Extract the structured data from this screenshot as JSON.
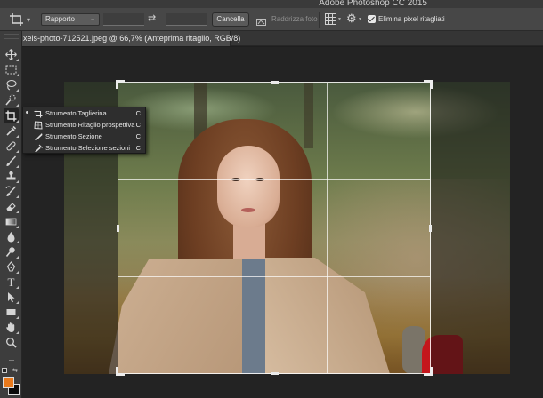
{
  "app": {
    "window_title": "Adobe Photoshop CC 2015"
  },
  "options_bar": {
    "ratio_select_value": "Rapporto",
    "width_value": "",
    "height_value": "",
    "cancel_label": "Cancella",
    "straighten_label": "Raddrizza foto",
    "delete_cropped_label": "Elimina pixel ritagliati",
    "delete_cropped_checked": true
  },
  "document_tab": {
    "label": "xels-photo-712521.jpeg @ 66,7% (Anteprima ritaglio, RGB/8)"
  },
  "toolbar": {
    "tools": [
      {
        "name": "move-tool",
        "icon": "move-icon"
      },
      {
        "name": "marquee-tool",
        "icon": "rect-marquee-icon"
      },
      {
        "name": "lasso-tool",
        "icon": "lasso-icon"
      },
      {
        "name": "quick-select-tool",
        "icon": "quick-select-icon"
      },
      {
        "name": "crop-tool",
        "icon": "crop-icon",
        "active": true
      },
      {
        "name": "eyedropper-tool",
        "icon": "eyedropper-icon"
      },
      {
        "name": "healing-tool",
        "icon": "bandage-icon"
      },
      {
        "name": "brush-tool",
        "icon": "brush-icon"
      },
      {
        "name": "stamp-tool",
        "icon": "stamp-icon"
      },
      {
        "name": "history-brush-tool",
        "icon": "history-brush-icon"
      },
      {
        "name": "eraser-tool",
        "icon": "eraser-icon"
      },
      {
        "name": "gradient-tool",
        "icon": "gradient-icon"
      },
      {
        "name": "blur-tool",
        "icon": "drop-icon"
      },
      {
        "name": "dodge-tool",
        "icon": "dodge-icon"
      },
      {
        "name": "pen-tool",
        "icon": "pen-icon"
      },
      {
        "name": "type-tool",
        "icon": "type-icon"
      },
      {
        "name": "path-select-tool",
        "icon": "arrow-icon"
      },
      {
        "name": "shape-tool",
        "icon": "rectangle-icon"
      },
      {
        "name": "hand-tool",
        "icon": "hand-icon"
      },
      {
        "name": "zoom-tool",
        "icon": "zoom-icon"
      },
      {
        "name": "more-tools",
        "icon": "ellipsis-icon"
      }
    ],
    "type_glyph": "T",
    "more_glyph": "···",
    "foreground_color": "#e8791c",
    "background_color": "#0a0a0a"
  },
  "crop_flyout": {
    "items": [
      {
        "label": "Strumento Taglierina",
        "shortcut": "C",
        "selected": true,
        "icon": "crop-icon"
      },
      {
        "label": "Strumento Ritaglio prospettiva",
        "shortcut": "C",
        "selected": false,
        "icon": "perspective-crop-icon"
      },
      {
        "label": "Strumento Sezione",
        "shortcut": "C",
        "selected": false,
        "icon": "slice-icon"
      },
      {
        "label": "Strumento Selezione sezioni",
        "shortcut": "C",
        "selected": false,
        "icon": "slice-select-icon"
      }
    ]
  },
  "colors": {
    "panel": "#474747",
    "toolbar": "#3d3d3d",
    "canvas": "#232323",
    "flyout": "#2e2e2e"
  }
}
